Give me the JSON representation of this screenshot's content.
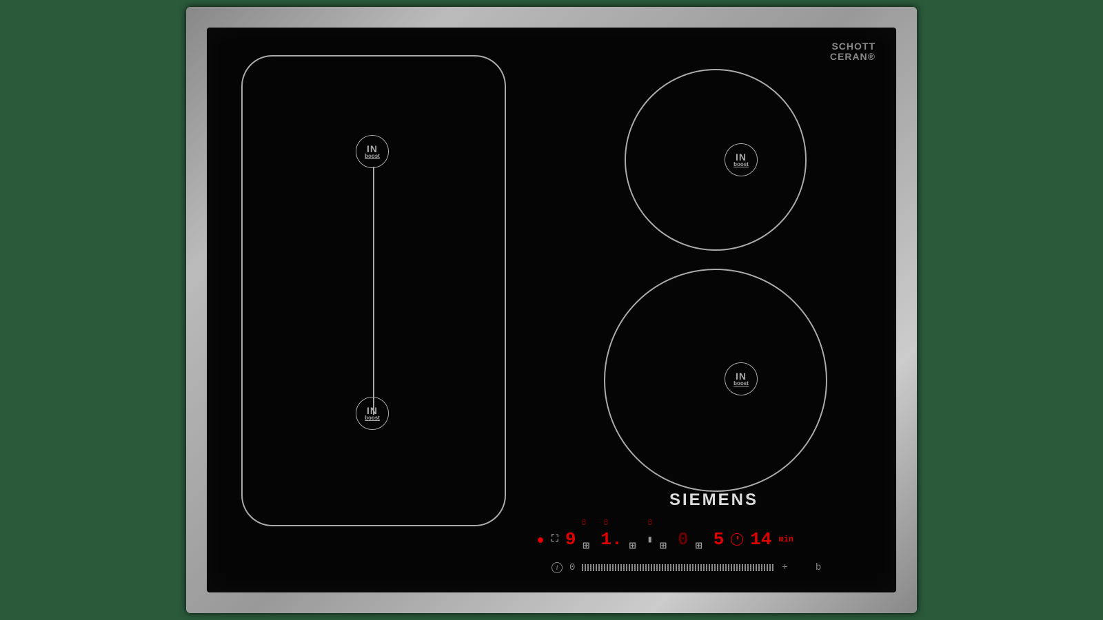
{
  "product": {
    "glass_brand_line1": "SCHOTT",
    "glass_brand_line2": "CERAN®",
    "glass_brand_sub": "",
    "brand": "SIEMENS",
    "zone_label_in": "IN",
    "zone_label_boost": "boost"
  },
  "display": {
    "indicators_row": [
      "8",
      "8",
      "",
      "8",
      "",
      "",
      ""
    ],
    "power_left_rear": "9",
    "power_left_front": "1.",
    "power_right_rear": "0",
    "power_right_front": "5",
    "timer": "14",
    "timer_unit": "min",
    "slider_zero": "0",
    "slider_plus": "+",
    "boost_letter": "b"
  },
  "colors": {
    "led": "#d00",
    "led_dim": "#700",
    "outline": "#aaa",
    "steel": "#a9a9a9",
    "glass": "#050505",
    "bg": "#2a5a3a"
  }
}
